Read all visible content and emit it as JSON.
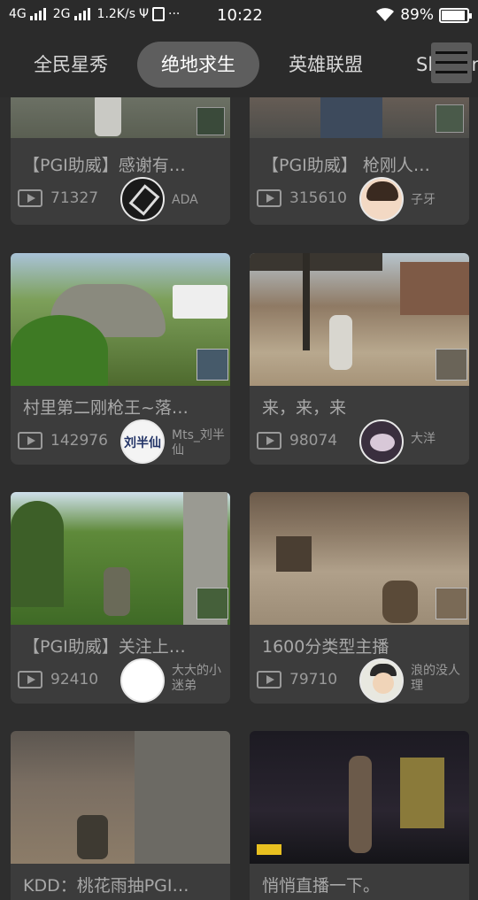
{
  "status_bar": {
    "net1": "4G",
    "net2": "2G",
    "speed": "1.2K/s",
    "dots": "···",
    "time": "10:22",
    "battery": "89%"
  },
  "tabs": [
    {
      "label": "全民星秀",
      "active": false
    },
    {
      "label": "绝地求生",
      "active": true
    },
    {
      "label": "英雄联盟",
      "active": false
    },
    {
      "label": "Showin",
      "active": false
    }
  ],
  "cards": [
    {
      "title": "【PGI助威】感谢有…",
      "views": "71327",
      "user": "ADA"
    },
    {
      "title": "【PGI助威】 枪刚人…",
      "views": "315610",
      "user": "子牙"
    },
    {
      "title": "村里第二刚枪王~落…",
      "views": "142976",
      "user": "Mts_刘半仙",
      "avatar_text": "刘半仙"
    },
    {
      "title": "来，来，来",
      "views": "98074",
      "user": "大洋"
    },
    {
      "title": "【PGI助威】关注上…",
      "views": "92410",
      "user": "大大的小迷弟"
    },
    {
      "title": "1600分类型主播",
      "views": "79710",
      "user": "浪的没人理"
    },
    {
      "title": "KDD：桃花雨抽PGI…",
      "views": "",
      "user": ""
    },
    {
      "title": "悄悄直播一下。",
      "views": "",
      "user": ""
    }
  ],
  "colors": {
    "background": "#2e2e2e",
    "card": "#3c3c3c",
    "active_tab": "#5e5e5e"
  }
}
